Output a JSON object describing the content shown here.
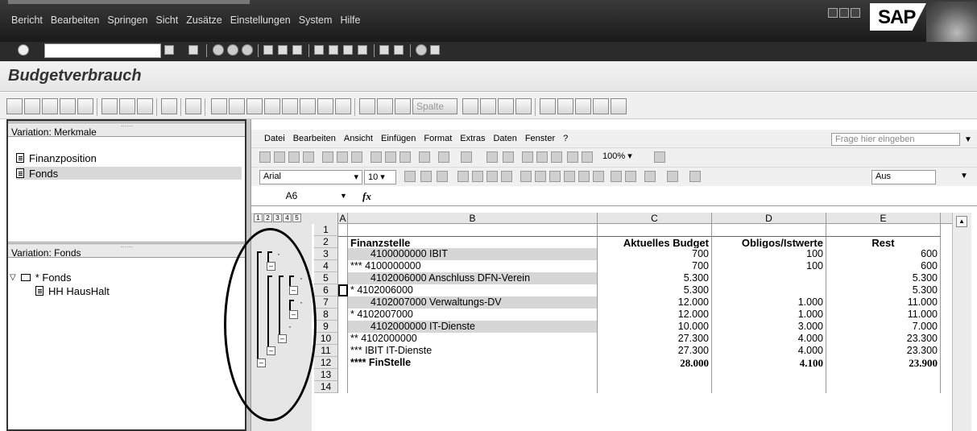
{
  "menubar": [
    "Bericht",
    "Bearbeiten",
    "Springen",
    "Sicht",
    "Zusätze",
    "Einstellungen",
    "System",
    "Hilfe"
  ],
  "brand": "SAP",
  "page_title": "Budgetverbrauch",
  "app_toolbar": {
    "spalte_label": "Spalte"
  },
  "left_pane": {
    "section1": {
      "title": "Variation: Merkmale",
      "items": [
        "Finanzposition",
        "Fonds"
      ]
    },
    "section2": {
      "title": "Variation: Fonds",
      "root": "* Fonds",
      "child": "HH HausHalt"
    }
  },
  "excel": {
    "menu": [
      "Datei",
      "Bearbeiten",
      "Ansicht",
      "Einfügen",
      "Format",
      "Extras",
      "Daten",
      "Fenster",
      "?"
    ],
    "ask_placeholder": "Frage hier eingeben",
    "font_name": "Arial",
    "font_size": "10",
    "zoom": "100%",
    "aus": "Aus",
    "name_box": "A6",
    "fx": "fx",
    "outline_levels": [
      "1",
      "2",
      "3",
      "4",
      "5"
    ],
    "columns": [
      "A",
      "B",
      "C",
      "D",
      "E"
    ],
    "header": {
      "b": "Finanzstelle",
      "c": "Aktuelles Budget",
      "d": "Obligos/Istwerte",
      "e": "Rest"
    },
    "rows": [
      {
        "r": "1",
        "a": "",
        "b": "",
        "c": "",
        "d": "",
        "e": ""
      },
      {
        "r": "2",
        "a": "",
        "b": "",
        "c": "",
        "d": "",
        "e": ""
      },
      {
        "r": "3",
        "a": "",
        "b": "4100000000  IBIT",
        "c": "700",
        "d": "100",
        "e": "600"
      },
      {
        "r": "4",
        "a": "",
        "b": "***  4100000000",
        "c": "700",
        "d": "100",
        "e": "600"
      },
      {
        "r": "5",
        "a": "",
        "b": "4102006000  Anschluss DFN-Verein",
        "c": "5.300",
        "d": "",
        "e": "5.300"
      },
      {
        "r": "6",
        "a": "",
        "b": "*  4102006000",
        "c": "5.300",
        "d": "",
        "e": "5.300"
      },
      {
        "r": "7",
        "a": "",
        "b": "4102007000  Verwaltungs-DV",
        "c": "12.000",
        "d": "1.000",
        "e": "11.000"
      },
      {
        "r": "8",
        "a": "",
        "b": "*  4102007000",
        "c": "12.000",
        "d": "1.000",
        "e": "11.000"
      },
      {
        "r": "9",
        "a": "",
        "b": "4102000000  IT-Dienste",
        "c": "10.000",
        "d": "3.000",
        "e": "7.000"
      },
      {
        "r": "10",
        "a": "",
        "b": "**  4102000000",
        "c": "27.300",
        "d": "4.000",
        "e": "23.300"
      },
      {
        "r": "11",
        "a": "",
        "b": "***  IBIT IT-Dienste",
        "c": "27.300",
        "d": "4.000",
        "e": "23.300"
      },
      {
        "r": "12",
        "a": "",
        "b": "****  FinStelle",
        "c": "28.000",
        "d": "4.100",
        "e": "23.900"
      },
      {
        "r": "13",
        "a": "",
        "b": "",
        "c": "",
        "d": "",
        "e": ""
      },
      {
        "r": "14",
        "a": "",
        "b": "",
        "c": "",
        "d": "",
        "e": ""
      }
    ]
  }
}
